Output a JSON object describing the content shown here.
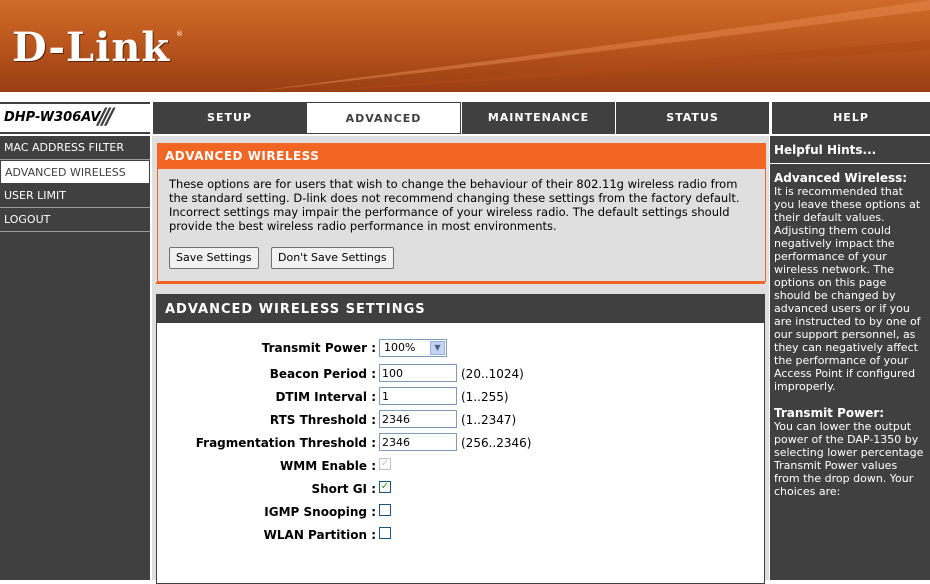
{
  "brand": {
    "logo": "D-Link",
    "trademark": "®",
    "model": "DHP-W306AV"
  },
  "nav": {
    "tabs": [
      {
        "label": "SETUP",
        "active": false
      },
      {
        "label": "ADVANCED",
        "active": true
      },
      {
        "label": "MAINTENANCE",
        "active": false
      },
      {
        "label": "STATUS",
        "active": false
      }
    ],
    "help": "HELP"
  },
  "sidebar": {
    "items": [
      {
        "label": "MAC ADDRESS FILTER",
        "active": false
      },
      {
        "label": "ADVANCED WIRELESS",
        "active": true
      },
      {
        "label": "USER LIMIT",
        "active": false
      },
      {
        "label": "LOGOUT",
        "active": false
      }
    ]
  },
  "intro": {
    "title": "ADVANCED WIRELESS",
    "description": "These options are for users that wish to change the behaviour of their 802.11g wireless radio from the standard setting. D-link does not recommend changing these settings from the factory default. Incorrect settings may impair the performance of your wireless radio. The default settings should provide the best wireless radio performance in most environments.",
    "save_label": "Save Settings",
    "dont_save_label": "Don't Save Settings"
  },
  "settings": {
    "title": "ADVANCED WIRELESS SETTINGS",
    "transmit_power": {
      "label": "Transmit Power :",
      "value": "100%"
    },
    "beacon_period": {
      "label": "Beacon Period :",
      "value": "100",
      "range": "(20..1024)"
    },
    "dtim_interval": {
      "label": "DTIM Interval :",
      "value": "1",
      "range": "(1..255)"
    },
    "rts_threshold": {
      "label": "RTS Threshold :",
      "value": "2346",
      "range": "(1..2347)"
    },
    "frag_threshold": {
      "label": "Fragmentation Threshold :",
      "value": "2346",
      "range": "(256..2346)"
    },
    "wmm_enable": {
      "label": "WMM Enable :",
      "checked": true,
      "disabled": true
    },
    "short_gi": {
      "label": "Short GI :",
      "checked": true
    },
    "igmp_snooping": {
      "label": "IGMP Snooping :",
      "checked": false
    },
    "wlan_partition": {
      "label": "WLAN Partition :",
      "checked": false
    }
  },
  "help": {
    "title": "Helpful Hints...",
    "section1_title": "Advanced Wireless:",
    "section1_text": "It is recommended that you leave these options at their default values. Adjusting them could negatively impact the performance of your wireless network. The options on this page should be changed by advanced users or if you are instructed to by one of our support personnel, as they can negatively affect the performance of your Access Point if configured improperly.",
    "section2_title": "Transmit Power:",
    "section2_text": "You can lower the output power of the DAP-1350 by selecting lower percentage Transmit Power values from the drop down. Your choices are:"
  },
  "colors": {
    "accent": "#f26522",
    "dark": "#404040",
    "panel": "#dfdfdf"
  }
}
